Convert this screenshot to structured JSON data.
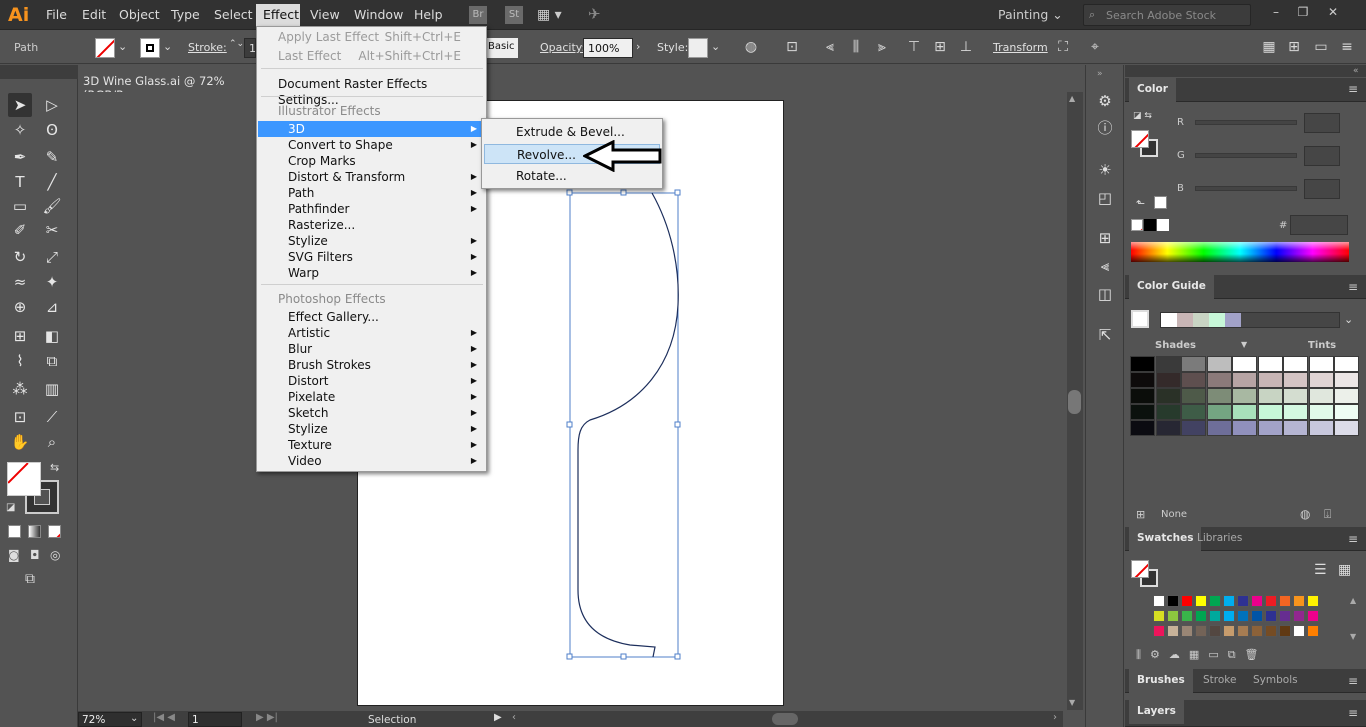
{
  "app": {
    "logo": "Ai"
  },
  "menubar": {
    "items": [
      "File",
      "Edit",
      "Object",
      "Type",
      "Select",
      "Effect",
      "View",
      "Window",
      "Help"
    ],
    "br": "Br",
    "st": "St",
    "workspace": "Painting",
    "search_placeholder": "Search Adobe Stock"
  },
  "control": {
    "path_label": "Path",
    "stroke_label": "Stroke:",
    "stroke_value": "1",
    "basic_label": "Basic",
    "opacity_label": "Opacity:",
    "opacity_value": "100%",
    "style_label": "Style:",
    "transform_label": "Transform"
  },
  "document": {
    "tab_title": "3D Wine Glass.ai @ 72% (RGB/Pre",
    "zoom": "72%",
    "artboard_num": "1",
    "status_tool": "Selection"
  },
  "effect_menu": {
    "apply_last": {
      "label": "Apply Last Effect",
      "shortcut": "Shift+Ctrl+E"
    },
    "last": {
      "label": "Last Effect",
      "shortcut": "Alt+Shift+Ctrl+E"
    },
    "doc_raster": "Document Raster Effects Settings...",
    "illustrator_header": "Illustrator Effects",
    "illustrator_items": [
      "3D",
      "Convert to Shape",
      "Crop Marks",
      "Distort & Transform",
      "Path",
      "Pathfinder",
      "Rasterize...",
      "Stylize",
      "SVG Filters",
      "Warp"
    ],
    "photoshop_header": "Photoshop Effects",
    "photoshop_items": [
      "Effect Gallery...",
      "Artistic",
      "Blur",
      "Brush Strokes",
      "Distort",
      "Pixelate",
      "Sketch",
      "Stylize",
      "Texture",
      "Video"
    ]
  },
  "submenu_3d": {
    "items": [
      "Extrude & Bevel...",
      "Revolve...",
      "Rotate..."
    ],
    "hovered": "Revolve..."
  },
  "color_panel": {
    "tab": "Color",
    "labels": {
      "r": "R",
      "g": "G",
      "b": "B",
      "hash": "#"
    }
  },
  "color_guide": {
    "tab": "Color Guide",
    "shades": "Shades",
    "tints": "Tints",
    "none_label": "None",
    "harmony": [
      "#ffffff",
      "#c8b5b5",
      "#c8d4c3",
      "#c7f7d8",
      "#a2a2c8"
    ],
    "grid": [
      [
        "#000000",
        "#3a3a3a",
        "#7b7b7b",
        "#bdbdbd",
        "#ffffff",
        "#ffffff",
        "#ffffff",
        "#ffffff",
        "#ffffff"
      ],
      [
        "#0e0b0b",
        "#342a2a",
        "#5e4f4f",
        "#8b7a7a",
        "#b7a4a4",
        "#c8b5b5",
        "#d4c4c4",
        "#e0d4d4",
        "#ece6e6"
      ],
      [
        "#0b0d0a",
        "#2a3127",
        "#4e5a49",
        "#7d8c77",
        "#a8b8a2",
        "#c8d4c3",
        "#d4ddd0",
        "#e0e7dd",
        "#ecf0ea"
      ],
      [
        "#0b110d",
        "#273a2c",
        "#3e5c47",
        "#74a582",
        "#a8e0bb",
        "#c7f7d8",
        "#d4f8e1",
        "#e1faea",
        "#eefdf4"
      ],
      [
        "#0b0b11",
        "#272733",
        "#424262",
        "#6e6e99",
        "#9090bc",
        "#a2a2c8",
        "#b5b5d2",
        "#c8c8dd",
        "#dcdce8"
      ]
    ]
  },
  "swatches": {
    "tab": "Swatches",
    "libraries_tab": "Libraries",
    "rows": [
      [
        "#ffffff",
        "#000000",
        "#ff0000",
        "#ffff00",
        "#00a651",
        "#00aeef",
        "#2e3192",
        "#ec008c",
        "#ed1c24",
        "#f26522",
        "#f7941d",
        "#fff200"
      ],
      [
        "#d7df23",
        "#8dc63f",
        "#39b54a",
        "#00a651",
        "#00a99d",
        "#00aeef",
        "#0072bc",
        "#0054a6",
        "#2e3192",
        "#662d91",
        "#92278f",
        "#ec008c"
      ],
      [
        "#ed145b",
        "#c7b299",
        "#998675",
        "#736357",
        "#534741",
        "#c69c6d",
        "#a67c52",
        "#8c6239",
        "#754c24",
        "#603913",
        "#ffffff",
        "#ff7f00"
      ]
    ]
  },
  "bottom_tabs": {
    "brushes": "Brushes",
    "stroke": "Stroke",
    "symbols": "Symbols",
    "layers": "Layers"
  }
}
